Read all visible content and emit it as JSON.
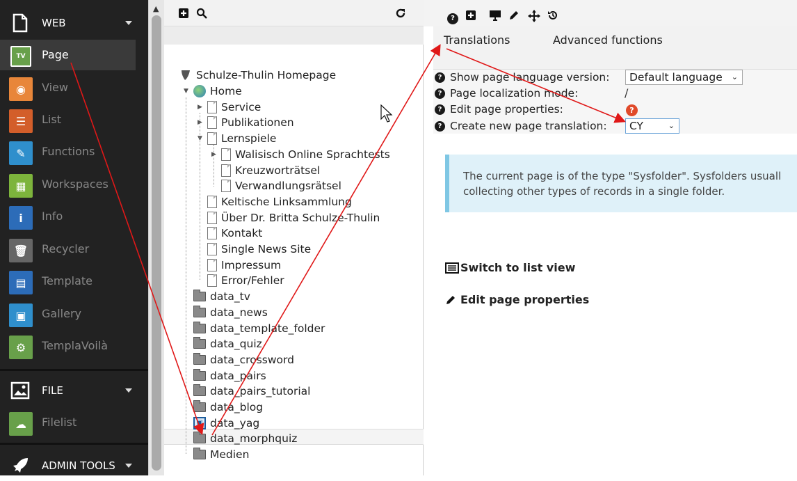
{
  "sidebar": {
    "web_section": {
      "label": "WEB",
      "icon": "document-icon"
    },
    "modules": [
      {
        "name": "Page",
        "icon": "page-module-icon",
        "color": "#68a04a",
        "glyph": "TV"
      },
      {
        "name": "View",
        "icon": "eye-icon",
        "color": "#e8863a",
        "glyph": "◉"
      },
      {
        "name": "List",
        "icon": "list-icon",
        "color": "#d35e2a",
        "glyph": "☰"
      },
      {
        "name": "Functions",
        "icon": "wand-icon",
        "color": "#2f8fcc",
        "glyph": "✎"
      },
      {
        "name": "Workspaces",
        "icon": "workspaces-icon",
        "color": "#7db43c",
        "glyph": "▦"
      },
      {
        "name": "Info",
        "icon": "info-icon",
        "color": "#2c6cb8",
        "glyph": "i"
      },
      {
        "name": "Recycler",
        "icon": "trash-icon",
        "color": "#666666",
        "glyph": "🗑"
      },
      {
        "name": "Template",
        "icon": "template-icon",
        "color": "#2c6cb8",
        "glyph": "▤"
      },
      {
        "name": "Gallery",
        "icon": "image-icon",
        "color": "#2f8fcc",
        "glyph": "▣"
      },
      {
        "name": "TemplaVoilà",
        "icon": "gear-icon",
        "color": "#68a04a",
        "glyph": "⚙"
      }
    ],
    "file_section": {
      "label": "FILE",
      "icon": "image-file-icon"
    },
    "file_modules": [
      {
        "name": "Filelist",
        "icon": "cloud-icon",
        "color": "#68a04a",
        "glyph": "☁"
      }
    ],
    "admin_section": {
      "label": "ADMIN TOOLS",
      "icon": "rocket-icon"
    }
  },
  "tree": {
    "toolbar": {
      "new_icon": "plus-square-icon",
      "search_icon": "search-icon",
      "refresh_icon": "refresh-icon"
    },
    "root": "Schulze-Thulin Homepage",
    "nodes": [
      {
        "label": "Home",
        "type": "globe"
      },
      {
        "label": "Service",
        "type": "page"
      },
      {
        "label": "Publikationen",
        "type": "page"
      },
      {
        "label": "Lernspiele",
        "type": "page"
      },
      {
        "label": "Walisisch Online Sprachtests",
        "type": "page"
      },
      {
        "label": "Kreuzworträtsel",
        "type": "page"
      },
      {
        "label": "Verwandlungsrätsel",
        "type": "page"
      },
      {
        "label": "Keltische Linksammlung",
        "type": "page"
      },
      {
        "label": "Über Dr. Britta Schulze-Thulin",
        "type": "page"
      },
      {
        "label": "Kontakt",
        "type": "page"
      },
      {
        "label": "Single News Site",
        "type": "page"
      },
      {
        "label": "Impressum",
        "type": "page"
      },
      {
        "label": "Error/Fehler",
        "type": "page"
      },
      {
        "label": "data_tv",
        "type": "folder"
      },
      {
        "label": "data_news",
        "type": "folder"
      },
      {
        "label": "data_template_folder",
        "type": "folder"
      },
      {
        "label": "data_quiz",
        "type": "folder"
      },
      {
        "label": "data_crossword",
        "type": "folder"
      },
      {
        "label": "data_pairs",
        "type": "folder"
      },
      {
        "label": "data_pairs_tutorial",
        "type": "folder"
      },
      {
        "label": "data_blog",
        "type": "folder"
      },
      {
        "label": "data_yag",
        "type": "yag"
      },
      {
        "label": "data_morphquiz",
        "type": "folder"
      },
      {
        "label": "Medien",
        "type": "folder"
      }
    ]
  },
  "main": {
    "toolbar_icons": [
      "help-icon",
      "plus-square-icon",
      "monitor-icon",
      "pencil-icon",
      "move-icon",
      "history-icon"
    ],
    "menu": {
      "translations": "Translations",
      "advanced": "Advanced functions"
    },
    "form": {
      "show_lang_label": "Show page language version:",
      "show_lang_value": "Default language",
      "localization_label": "Page localization mode:",
      "localization_value": "/",
      "edit_props_label": "Edit page properties:",
      "create_translation_label": "Create new page translation:",
      "create_translation_value": "CY"
    },
    "info_line1": "The current page is of the type \"Sysfolder\". Sysfolders usuall",
    "info_line2": "collecting other types of records in a single folder.",
    "switch_list": "Switch to list view",
    "edit_props": "Edit page properties"
  },
  "colors": {
    "annotation_arrow": "#e01818",
    "info_bg": "#dff1f9",
    "info_border": "#7fc7e4"
  }
}
